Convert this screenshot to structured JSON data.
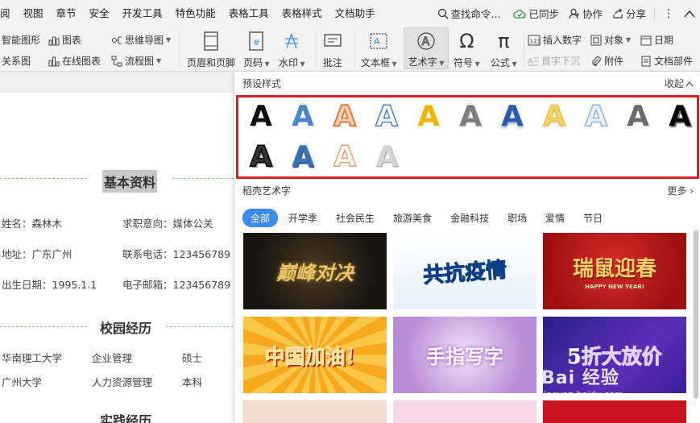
{
  "menu": [
    "阅",
    "视图",
    "章节",
    "安全",
    "开发工具",
    "特色功能",
    "表格工具",
    "表格样式",
    "文档助手"
  ],
  "menu_right": {
    "search": "查找命令...",
    "sync": "已同步",
    "collab": "协作",
    "share": "分享"
  },
  "ribbon": {
    "smart_graphic": "智能图形",
    "chart": "图表",
    "mindmap": "思维导图",
    "relation_map": "关系图",
    "online_chart": "在线图表",
    "flowchart": "流程图",
    "header_footer": "页眉和页脚",
    "page_number": "页码",
    "watermark": "水印",
    "comment": "批注",
    "textbox": "文本框",
    "wordart": "艺术字",
    "symbol": "符号",
    "formula": "公式",
    "insert_number": "插入数字",
    "object": "对象",
    "date": "日期",
    "dropcap": "首字下沉",
    "attachment": "附件",
    "doc_parts": "文档部件"
  },
  "doc": {
    "basic_title": "基本资料",
    "name": "姓名：森林木",
    "job_intent": "求职意向：媒体公关",
    "address": "地址：广东广州",
    "phone": "联系电话：123456789",
    "birth": "出生日期：1995.1.1",
    "email": "电子邮箱：123456789",
    "campus_title": "校园经历",
    "school1": "华南理工大学",
    "major1": "企业管理",
    "degree1": "硕士",
    "school2": "广州大学",
    "major2": "人力资源管理",
    "degree2": "本科",
    "practice_title": "实践经历"
  },
  "panel": {
    "preset_title": "预设样式",
    "collapse": "收起",
    "preset_letter": "A",
    "wordart_title": "稻壳艺术字",
    "more": "更多",
    "tabs": [
      "全部",
      "开学季",
      "社会民生",
      "旅游美食",
      "金融科技",
      "职场",
      "爱情",
      "节日"
    ],
    "thumbs": [
      "巅峰对决",
      "共抗疫情",
      "瑞鼠迎春",
      "中国加油！",
      "手指写字",
      "5折大放价"
    ],
    "thumb_sub": "HAPPY NEW YEAR!"
  },
  "watermark": {
    "main": "Bai 经验",
    "sub": "jingyan.baidu.com"
  },
  "colors": {
    "accent": "#3c8cf0",
    "highlight_border": "#e02020",
    "menubar": "#f3f3f3"
  }
}
